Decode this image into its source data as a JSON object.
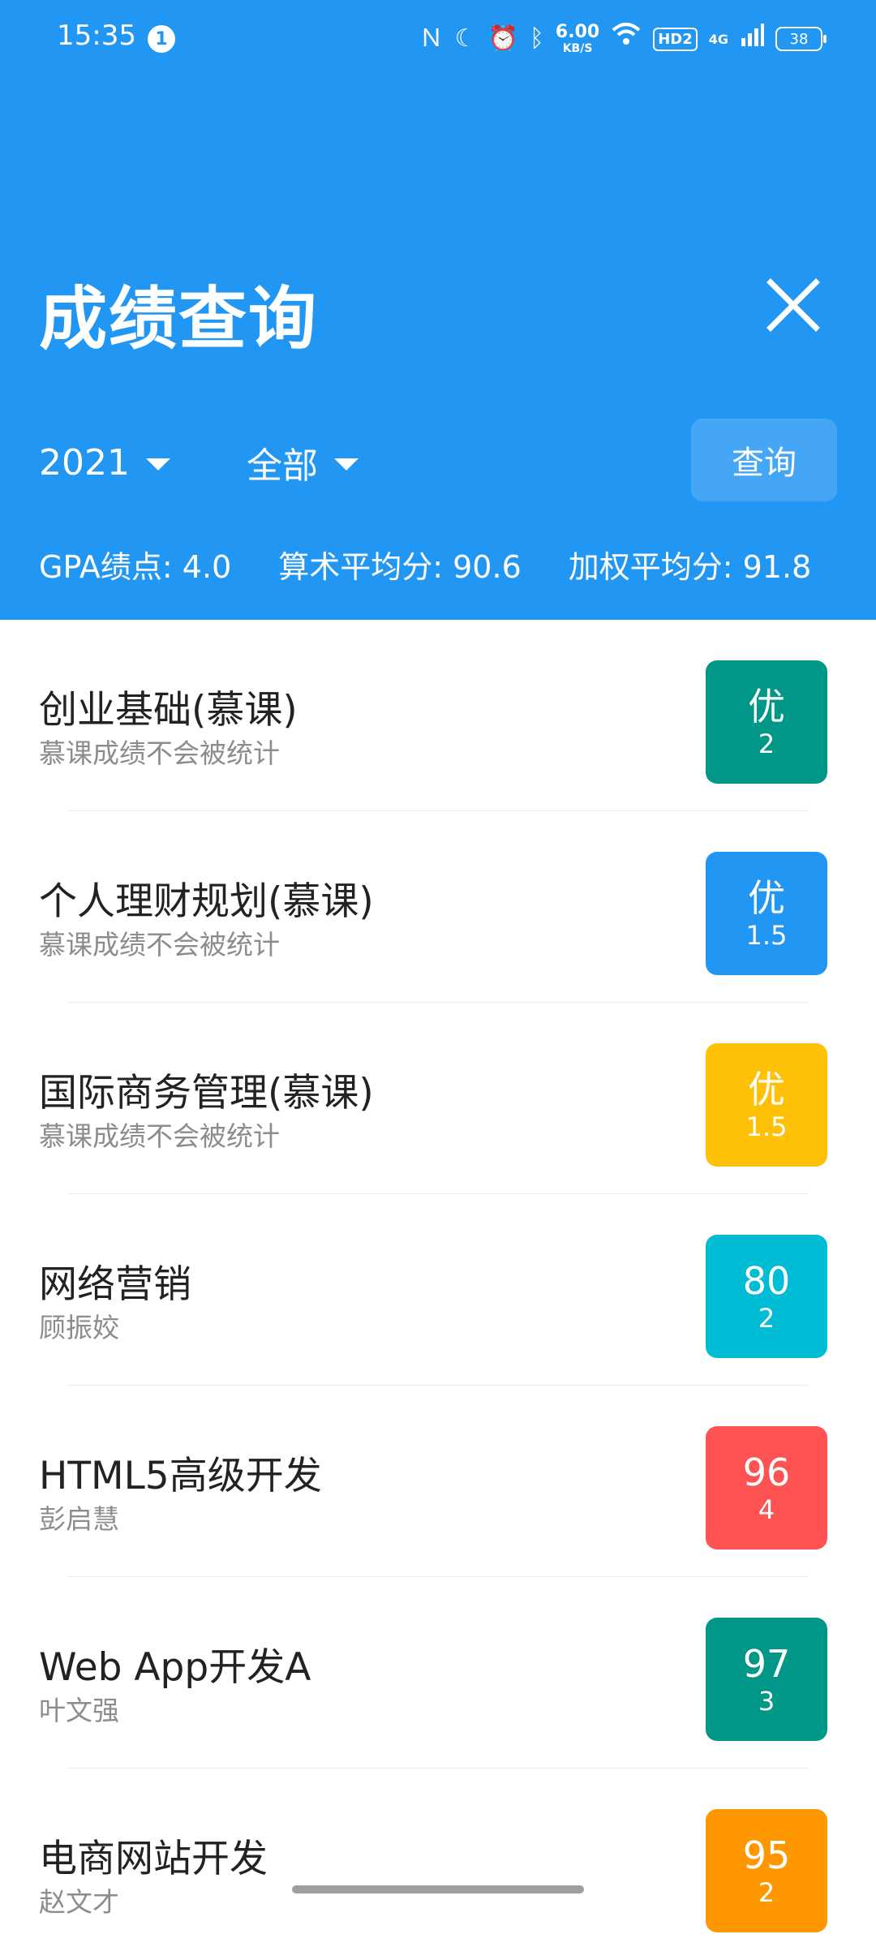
{
  "status_bar": {
    "time": "15:35",
    "notification_count": "1",
    "net_speed_value": "6.00",
    "net_speed_unit": "KB/S",
    "hd_label": "HD2",
    "network_type": "4G",
    "battery": "38"
  },
  "header": {
    "title": "成绩查询",
    "year": "2021",
    "term": "全部",
    "query_label": "查询",
    "stats": {
      "gpa": "GPA绩点: 4.0",
      "arith_avg": "算术平均分: 90.6",
      "weighted_avg": "加权平均分: 91.8"
    }
  },
  "grades": [
    {
      "name": "创业基础(慕课)",
      "sub": "慕课成绩不会被统计",
      "score": "优",
      "credit": "2",
      "color": "#009688"
    },
    {
      "name": "个人理财规划(慕课)",
      "sub": "慕课成绩不会被统计",
      "score": "优",
      "credit": "1.5",
      "color": "#2196f3"
    },
    {
      "name": "国际商务管理(慕课)",
      "sub": "慕课成绩不会被统计",
      "score": "优",
      "credit": "1.5",
      "color": "#ffc107"
    },
    {
      "name": "网络营销",
      "sub": "顾振姣",
      "score": "80",
      "credit": "2",
      "color": "#00bcd4"
    },
    {
      "name": "HTML5高级开发",
      "sub": "彭启慧",
      "score": "96",
      "credit": "4",
      "color": "#ff5252"
    },
    {
      "name": "Web App开发A",
      "sub": "叶文强",
      "score": "97",
      "credit": "3",
      "color": "#009688"
    },
    {
      "name": "电商网站开发",
      "sub": "赵文才",
      "score": "95",
      "credit": "2",
      "color": "#ff9800"
    }
  ],
  "colors": {
    "primary": "#2196f3"
  }
}
